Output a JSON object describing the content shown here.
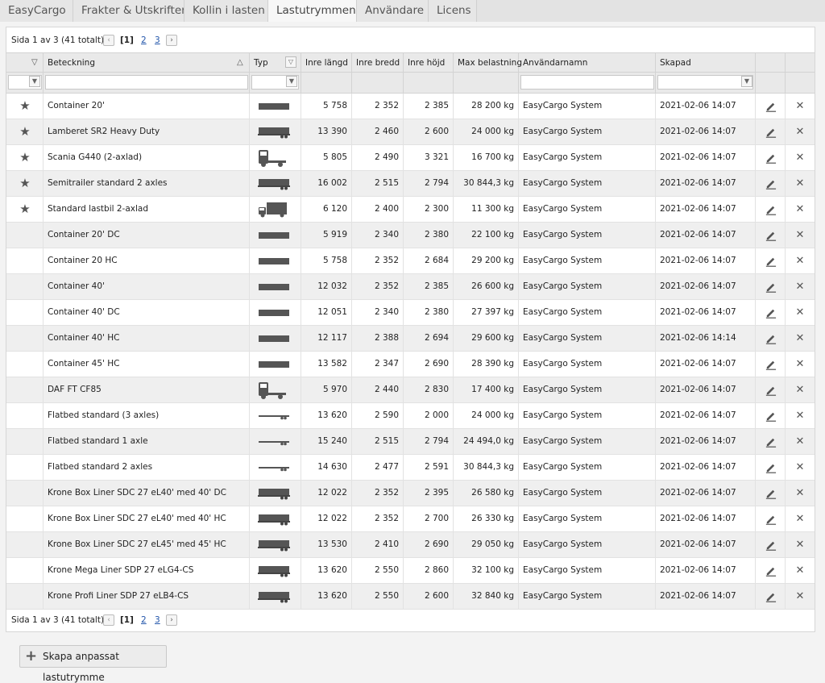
{
  "tabs": [
    "EasyCargo",
    "Frakter & Utskrifter",
    "Kollin i lasten",
    "Lastutrymmen",
    "Användare",
    "Licens"
  ],
  "pager": {
    "text": "Sida 1 av 3 (41 totalt)",
    "current": "[1]",
    "page2": "2",
    "page3": "3",
    "prev_icon": "chevron-left-icon",
    "next_icon": "chevron-right-icon"
  },
  "columns": {
    "name": "Beteckning",
    "type": "Typ",
    "length": "Inre längd",
    "width": "Inre bredd",
    "height": "Inre höjd",
    "load": "Max belastning",
    "user": "Användarnamn",
    "created": "Skapad"
  },
  "rows": [
    {
      "fav": true,
      "name": "Container 20'",
      "type": "container",
      "length": "5 758",
      "width": "2 352",
      "height": "2 385",
      "load": "28 200 kg",
      "user": "EasyCargo System",
      "created": "2021-02-06 14:07"
    },
    {
      "fav": true,
      "name": "Lamberet SR2 Heavy Duty",
      "type": "semitrailer",
      "length": "13 390",
      "width": "2 460",
      "height": "2 600",
      "load": "24 000 kg",
      "user": "EasyCargo System",
      "created": "2021-02-06 14:07"
    },
    {
      "fav": true,
      "name": "Scania G440 (2-axlad)",
      "type": "tractor",
      "length": "5 805",
      "width": "2 490",
      "height": "3 321",
      "load": "16 700 kg",
      "user": "EasyCargo System",
      "created": "2021-02-06 14:07"
    },
    {
      "fav": true,
      "name": "Semitrailer standard 2 axles",
      "type": "semitrailer",
      "length": "16 002",
      "width": "2 515",
      "height": "2 794",
      "load": "30 844,3 kg",
      "user": "EasyCargo System",
      "created": "2021-02-06 14:07"
    },
    {
      "fav": true,
      "name": "Standard lastbil 2-axlad",
      "type": "truck",
      "length": "6 120",
      "width": "2 400",
      "height": "2 300",
      "load": "11 300 kg",
      "user": "EasyCargo System",
      "created": "2021-02-06 14:07"
    },
    {
      "fav": false,
      "name": "Container 20' DC",
      "type": "container",
      "length": "5 919",
      "width": "2 340",
      "height": "2 380",
      "load": "22 100 kg",
      "user": "EasyCargo System",
      "created": "2021-02-06 14:07"
    },
    {
      "fav": false,
      "name": "Container 20 HC",
      "type": "container",
      "length": "5 758",
      "width": "2 352",
      "height": "2 684",
      "load": "29 200 kg",
      "user": "EasyCargo System",
      "created": "2021-02-06 14:07"
    },
    {
      "fav": false,
      "name": "Container 40'",
      "type": "container",
      "length": "12 032",
      "width": "2 352",
      "height": "2 385",
      "load": "26 600 kg",
      "user": "EasyCargo System",
      "created": "2021-02-06 14:07"
    },
    {
      "fav": false,
      "name": "Container 40' DC",
      "type": "container",
      "length": "12 051",
      "width": "2 340",
      "height": "2 380",
      "load": "27 397 kg",
      "user": "EasyCargo System",
      "created": "2021-02-06 14:07"
    },
    {
      "fav": false,
      "name": "Container 40' HC",
      "type": "container",
      "length": "12 117",
      "width": "2 388",
      "height": "2 694",
      "load": "29 600 kg",
      "user": "EasyCargo System",
      "created": "2021-02-06 14:14"
    },
    {
      "fav": false,
      "name": "Container 45' HC",
      "type": "container",
      "length": "13 582",
      "width": "2 347",
      "height": "2 690",
      "load": "28 390 kg",
      "user": "EasyCargo System",
      "created": "2021-02-06 14:07"
    },
    {
      "fav": false,
      "name": "DAF FT CF85",
      "type": "tractor",
      "length": "5 970",
      "width": "2 440",
      "height": "2 830",
      "load": "17 400 kg",
      "user": "EasyCargo System",
      "created": "2021-02-06 14:07"
    },
    {
      "fav": false,
      "name": "Flatbed standard (3 axles)",
      "type": "flatbed",
      "length": "13 620",
      "width": "2 590",
      "height": "2 000",
      "load": "24 000 kg",
      "user": "EasyCargo System",
      "created": "2021-02-06 14:07"
    },
    {
      "fav": false,
      "name": "Flatbed standard 1 axle",
      "type": "flatbed",
      "length": "15 240",
      "width": "2 515",
      "height": "2 794",
      "load": "24 494,0 kg",
      "user": "EasyCargo System",
      "created": "2021-02-06 14:07"
    },
    {
      "fav": false,
      "name": "Flatbed standard 2 axles",
      "type": "flatbed",
      "length": "14 630",
      "width": "2 477",
      "height": "2 591",
      "load": "30 844,3 kg",
      "user": "EasyCargo System",
      "created": "2021-02-06 14:07"
    },
    {
      "fav": false,
      "name": "Krone Box Liner SDC 27 eL40' med 40' DC",
      "type": "semitrailer",
      "length": "12 022",
      "width": "2 352",
      "height": "2 395",
      "load": "26 580 kg",
      "user": "EasyCargo System",
      "created": "2021-02-06 14:07"
    },
    {
      "fav": false,
      "name": "Krone Box Liner SDC 27 eL40' med 40' HC",
      "type": "semitrailer",
      "length": "12 022",
      "width": "2 352",
      "height": "2 700",
      "load": "26 330 kg",
      "user": "EasyCargo System",
      "created": "2021-02-06 14:07"
    },
    {
      "fav": false,
      "name": "Krone Box Liner SDC 27 eL45' med 45' HC",
      "type": "semitrailer",
      "length": "13 530",
      "width": "2 410",
      "height": "2 690",
      "load": "29 050 kg",
      "user": "EasyCargo System",
      "created": "2021-02-06 14:07"
    },
    {
      "fav": false,
      "name": "Krone Mega Liner SDP 27 eLG4-CS",
      "type": "semitrailer",
      "length": "13 620",
      "width": "2 550",
      "height": "2 860",
      "load": "32 100 kg",
      "user": "EasyCargo System",
      "created": "2021-02-06 14:07"
    },
    {
      "fav": false,
      "name": "Krone Profi Liner SDP 27 eLB4-CS",
      "type": "semitrailer",
      "length": "13 620",
      "width": "2 550",
      "height": "2 600",
      "load": "32 840 kg",
      "user": "EasyCargo System",
      "created": "2021-02-06 14:07"
    }
  ],
  "icons": {
    "favorite": "star-icon",
    "edit": "pencil-icon",
    "delete": "delete-icon",
    "filter": "filter-icon",
    "sort": "sort-icon",
    "dropdown": "chevron-down-icon"
  },
  "create_button": {
    "label": "Skapa anpassat lastutrymme",
    "icon": "plus-icon"
  }
}
